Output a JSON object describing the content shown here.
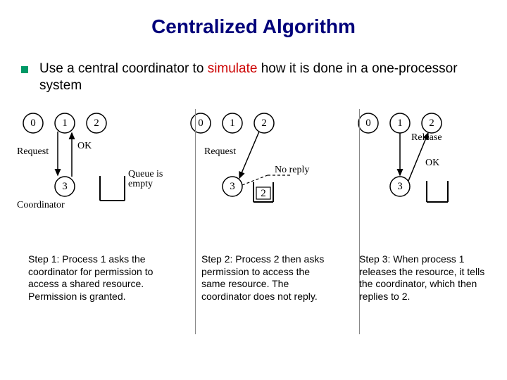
{
  "title": "Centralized Algorithm",
  "bullet_pre": "Use a central coordinator to ",
  "bullet_hl": "simulate",
  "bullet_post": " how it is done in a one-processor system",
  "labels": {
    "request": "Request",
    "ok": "OK",
    "coordinator": "Coordinator",
    "queue_empty": "Queue is\nempty",
    "no_reply": "No reply",
    "release": "Release"
  },
  "nodes": {
    "n0": "0",
    "n1": "1",
    "n2": "2",
    "n3": "3",
    "q2": "2"
  },
  "captions": {
    "step1": "Step 1: Process 1 asks the coordinator for permission to access a shared resource. Permission is granted.",
    "step2": "Step 2: Process 2 then asks permission to access the same resource. The coordinator does not reply.",
    "step3": "Step 3: When process 1 releases the resource, it tells the coordinator, which then replies to 2."
  },
  "chart_data": [
    {
      "type": "diagram",
      "title": "Step 1",
      "nodes": [
        {
          "id": 0,
          "role": "process"
        },
        {
          "id": 1,
          "role": "process"
        },
        {
          "id": 2,
          "role": "process"
        },
        {
          "id": 3,
          "role": "coordinator"
        }
      ],
      "messages": [
        {
          "from": 1,
          "to": 3,
          "label": "Request"
        },
        {
          "from": 3,
          "to": 1,
          "label": "OK"
        }
      ],
      "queue": "empty"
    },
    {
      "type": "diagram",
      "title": "Step 2",
      "nodes": [
        {
          "id": 0,
          "role": "process"
        },
        {
          "id": 1,
          "role": "process"
        },
        {
          "id": 2,
          "role": "process"
        },
        {
          "id": 3,
          "role": "coordinator"
        }
      ],
      "messages": [
        {
          "from": 2,
          "to": 3,
          "label": "Request"
        },
        {
          "from": 3,
          "to": 2,
          "label": "No reply",
          "blocked": true
        }
      ],
      "queue": [
        2
      ]
    },
    {
      "type": "diagram",
      "title": "Step 3",
      "nodes": [
        {
          "id": 0,
          "role": "process"
        },
        {
          "id": 1,
          "role": "process"
        },
        {
          "id": 2,
          "role": "process"
        },
        {
          "id": 3,
          "role": "coordinator"
        }
      ],
      "messages": [
        {
          "from": 1,
          "to": 3,
          "label": "Release"
        },
        {
          "from": 3,
          "to": 2,
          "label": "OK"
        }
      ],
      "queue": "empty"
    }
  ]
}
